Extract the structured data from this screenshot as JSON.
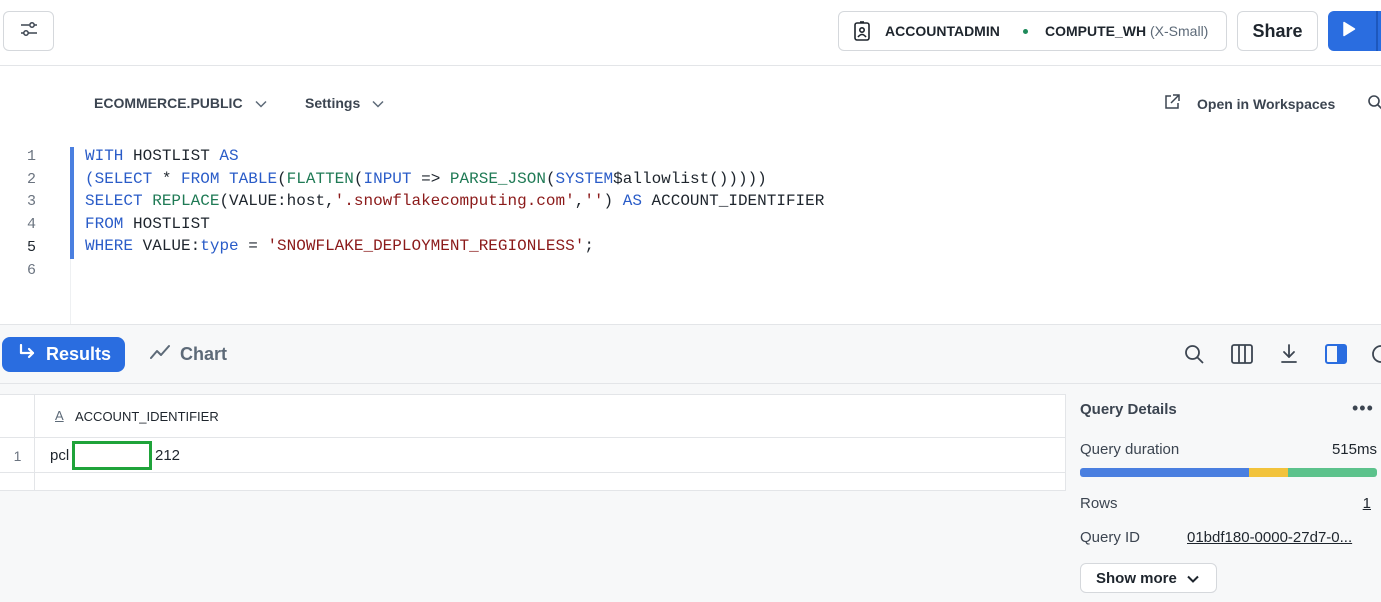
{
  "header": {
    "role": "ACCOUNTADMIN",
    "warehouse": "COMPUTE_WH",
    "warehouse_size": "(X-Small)",
    "share_label": "Share",
    "status_dot_color": "#1e8a5a",
    "run_button_color": "#2a6de0"
  },
  "editor_toolbar": {
    "database": "ECOMMERCE.PUBLIC",
    "settings_label": "Settings",
    "open_workspaces_label": "Open in Workspaces"
  },
  "editor": {
    "line_numbers": [
      "1",
      "2",
      "3",
      "4",
      "5",
      "6"
    ],
    "active_line": "5",
    "lines": [
      "WITH HOSTLIST AS",
      "(SELECT * FROM TABLE(FLATTEN(INPUT => PARSE_JSON(SYSTEM$allowlist()))))",
      "SELECT REPLACE(VALUE:host,'.snowflakecomputing.com','') AS ACCOUNT_IDENTIFIER",
      "FROM HOSTLIST",
      "WHERE VALUE:type = 'SNOWFLAKE_DEPLOYMENT_REGIONLESS';",
      ""
    ]
  },
  "results_bar": {
    "results_tab": "Results",
    "chart_tab": "Chart"
  },
  "grid": {
    "column_type_icon": "A",
    "columns": [
      "ACCOUNT_IDENTIFIER"
    ],
    "rows": [
      {
        "num": "1",
        "prefix": "pcl",
        "suffix": "212"
      }
    ],
    "redaction_color": "#1fa33a"
  },
  "query_details": {
    "title": "Query Details",
    "duration_label": "Query duration",
    "duration_value": "515ms",
    "duration_breakdown": [
      {
        "color": "#4a7fe0",
        "fraction": 0.57
      },
      {
        "color": "#f2c33c",
        "fraction": 0.13
      },
      {
        "color": "#5cc28c",
        "fraction": 0.3
      }
    ],
    "rows_label": "Rows",
    "rows_value": "1",
    "query_id_label": "Query ID",
    "query_id_value": "01bdf180-0000-27d7-0...",
    "show_more_label": "Show more"
  }
}
